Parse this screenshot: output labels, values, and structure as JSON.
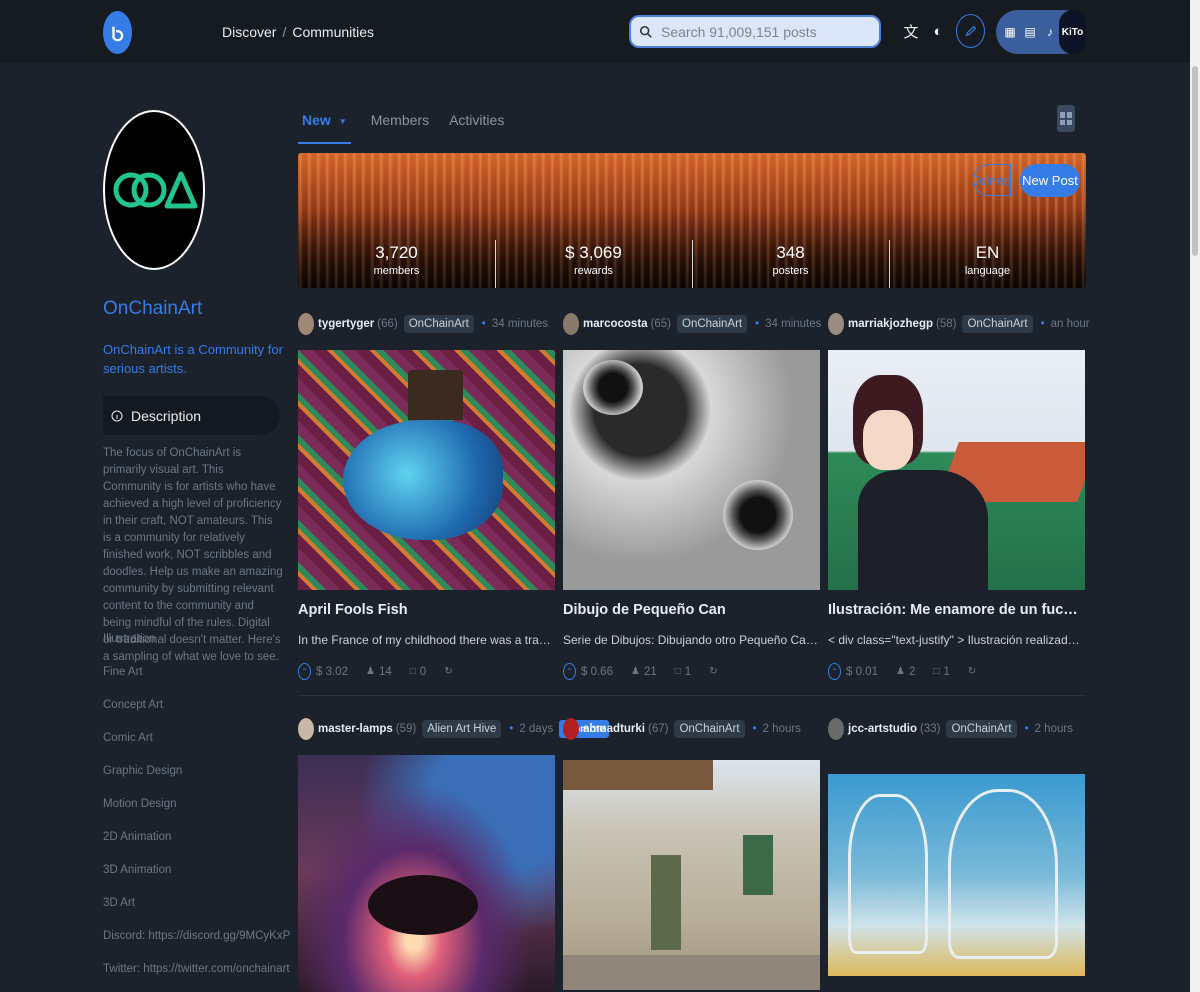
{
  "header": {
    "breadcrumbs": [
      "Discover",
      "Communities"
    ],
    "search_placeholder": "Search 91,009,151 posts",
    "avatar_initials": "KiTo"
  },
  "community": {
    "name": "OnChainArt",
    "about": "OnChainArt is a Community for serious artists.",
    "description_label": "Description",
    "description": "The focus of OnChainArt is primarily visual art. This Community is for artists who have achieved a high level of proficiency in their craft, NOT amateurs. This is a community for relatively finished work, NOT scribbles and doodles. Help us make an amazing community by submitting relevant content to the community and being mindful of the rules. Digital or traditional doesn't matter. Here's a sampling of what we love to see.",
    "topics": [
      "Illustration",
      "Fine Art",
      "Concept Art",
      "Comic Art",
      "Graphic Design",
      "Motion Design",
      "2D Animation",
      "3D Animation",
      "3D Art",
      "Discord: https://discord.gg/9MCyKxP",
      "Twitter: https://twitter.com/onchainart"
    ]
  },
  "tabs": [
    "New",
    "Members",
    "Activities"
  ],
  "hero": {
    "stats": [
      {
        "value": "3,720",
        "label": "members"
      },
      {
        "value": "$ 3,069",
        "label": "rewards"
      },
      {
        "value": "348",
        "label": "posters"
      },
      {
        "value": "EN",
        "label": "language"
      }
    ],
    "joined_label": "Joined",
    "new_post_label": "New Post"
  },
  "posts": [
    {
      "author": "tygertyger",
      "rep": "(66)",
      "community": "OnChainArt",
      "time": "34 minutes",
      "title": "April Fools Fish",
      "summary": "In the France of my childhood there was a tradition wh...",
      "payout": "$ 3.02",
      "votes": "14",
      "comments": "0",
      "promoted": ""
    },
    {
      "author": "marcocosta",
      "rep": "(65)",
      "community": "OnChainArt",
      "time": "34 minutes",
      "title": "Dibujo de Pequeño Can",
      "summary": "Serie de Dibujos: Dibujando otro Pequeño Can ¡Hola a...",
      "payout": "$ 0.66",
      "votes": "21",
      "comments": "1",
      "promoted": ""
    },
    {
      "author": "marriakjozhegp",
      "rep": "(58)",
      "community": "OnChainArt",
      "time": "an hour",
      "title": "Ilustración: Me enamore de un fuckboy. / Illus...",
      "summary": "< div class=\"text-justify\" > Ilustración realizada en Illust...",
      "payout": "$ 0.01",
      "votes": "2",
      "comments": "1",
      "promoted": ""
    },
    {
      "author": "master-lamps",
      "rep": "(59)",
      "community": "Alien Art Hive",
      "time": "2 days",
      "title": "",
      "summary": "",
      "payout": "",
      "votes": "",
      "comments": "",
      "promoted": "promote"
    },
    {
      "author": "ahmadturki",
      "rep": "(67)",
      "community": "OnChainArt",
      "time": "2 hours",
      "title": "",
      "summary": "",
      "payout": "",
      "votes": "",
      "comments": "",
      "promoted": ""
    },
    {
      "author": "jcc-artstudio",
      "rep": "(33)",
      "community": "OnChainArt",
      "time": "2 hours",
      "title": "",
      "summary": "",
      "payout": "",
      "votes": "",
      "comments": "",
      "promoted": ""
    }
  ],
  "colors": {
    "accent": "#357ce6",
    "background": "#1c222c",
    "topbar": "#161b22"
  }
}
